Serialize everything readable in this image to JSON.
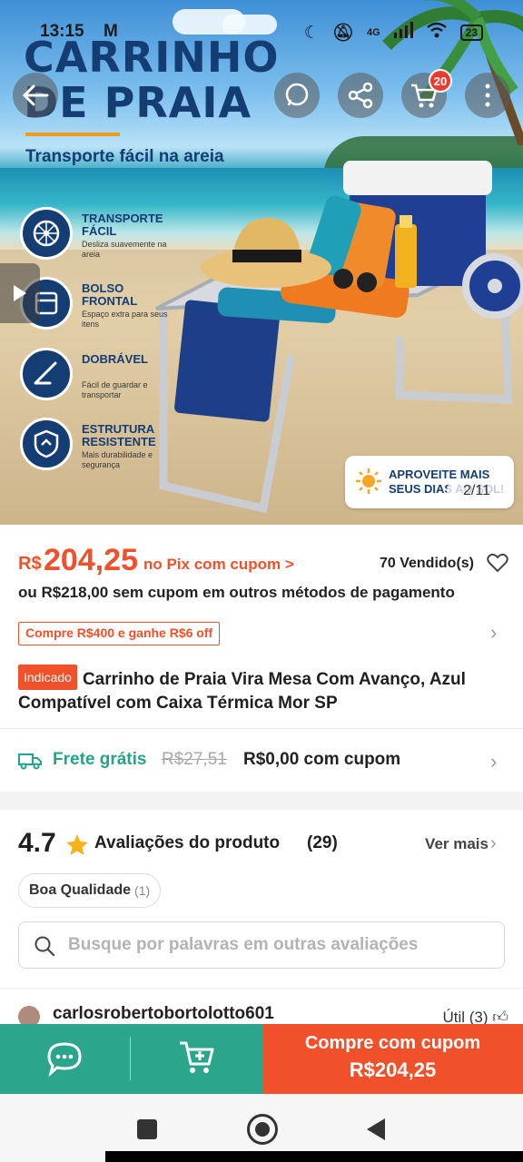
{
  "status_bar": {
    "time": "13:15",
    "mail_icon": "M",
    "network": "4G",
    "battery": "23"
  },
  "hero": {
    "title_line1": "CARRINHO",
    "title_line2": "DE PRAIA",
    "subtitle": "Transporte fácil na areia",
    "cart_badge": "20",
    "features": [
      {
        "title": "TRANSPORTE FÁCIL",
        "desc": "Desliza suavemente na areia",
        "icon": "wheel-icon"
      },
      {
        "title": "BOLSO FRONTAL",
        "desc": "Espaço extra para seus itens",
        "icon": "pocket-icon"
      },
      {
        "title": "DOBRÁVEL",
        "desc": "Fácil de guardar e transportar",
        "icon": "fold-icon"
      },
      {
        "title": "ESTRUTURA RESISTENTE",
        "desc": "Mais durabilidade e segurança",
        "icon": "shield-icon"
      }
    ],
    "promo_text_line1": "APROVEITE MAIS",
    "promo_text_line2": "SEUS DIAS AO SOL!",
    "image_counter": "2/11"
  },
  "price": {
    "currency": "R$",
    "amount": "204,25",
    "pix_label": "no Pix com cupom >",
    "sold": "70 Vendido(s)",
    "alt_price": "ou R$218,00 sem cupom em outros métodos de pagamento",
    "coupon_offer": "Compre R$400 e ganhe R$6 off"
  },
  "product": {
    "tag": "Indicado",
    "title": "Carrinho de Praia Vira Mesa Com Avanço, Azul Compatível com Caixa Térmica Mor SP"
  },
  "shipping": {
    "free_label": "Frete grátis",
    "old_price": "R$27,51",
    "new_price": "R$0,00 com cupom"
  },
  "reviews": {
    "rating": "4.7",
    "title": "Avaliações do produto",
    "count": "(29)",
    "see_more": "Ver mais",
    "chip_label": "Boa Qualidade",
    "chip_count": "(1)",
    "search_placeholder": "Busque por palavras em outras avaliações",
    "first_user": "carlosrobertobortolotto601",
    "useful": "Útil (3)"
  },
  "bottom_bar": {
    "buy_line1": "Compre com cupom",
    "buy_line2": "R$204,25"
  },
  "colors": {
    "accent": "#f0512a",
    "green": "#2ba58c",
    "navy": "#143d73"
  }
}
